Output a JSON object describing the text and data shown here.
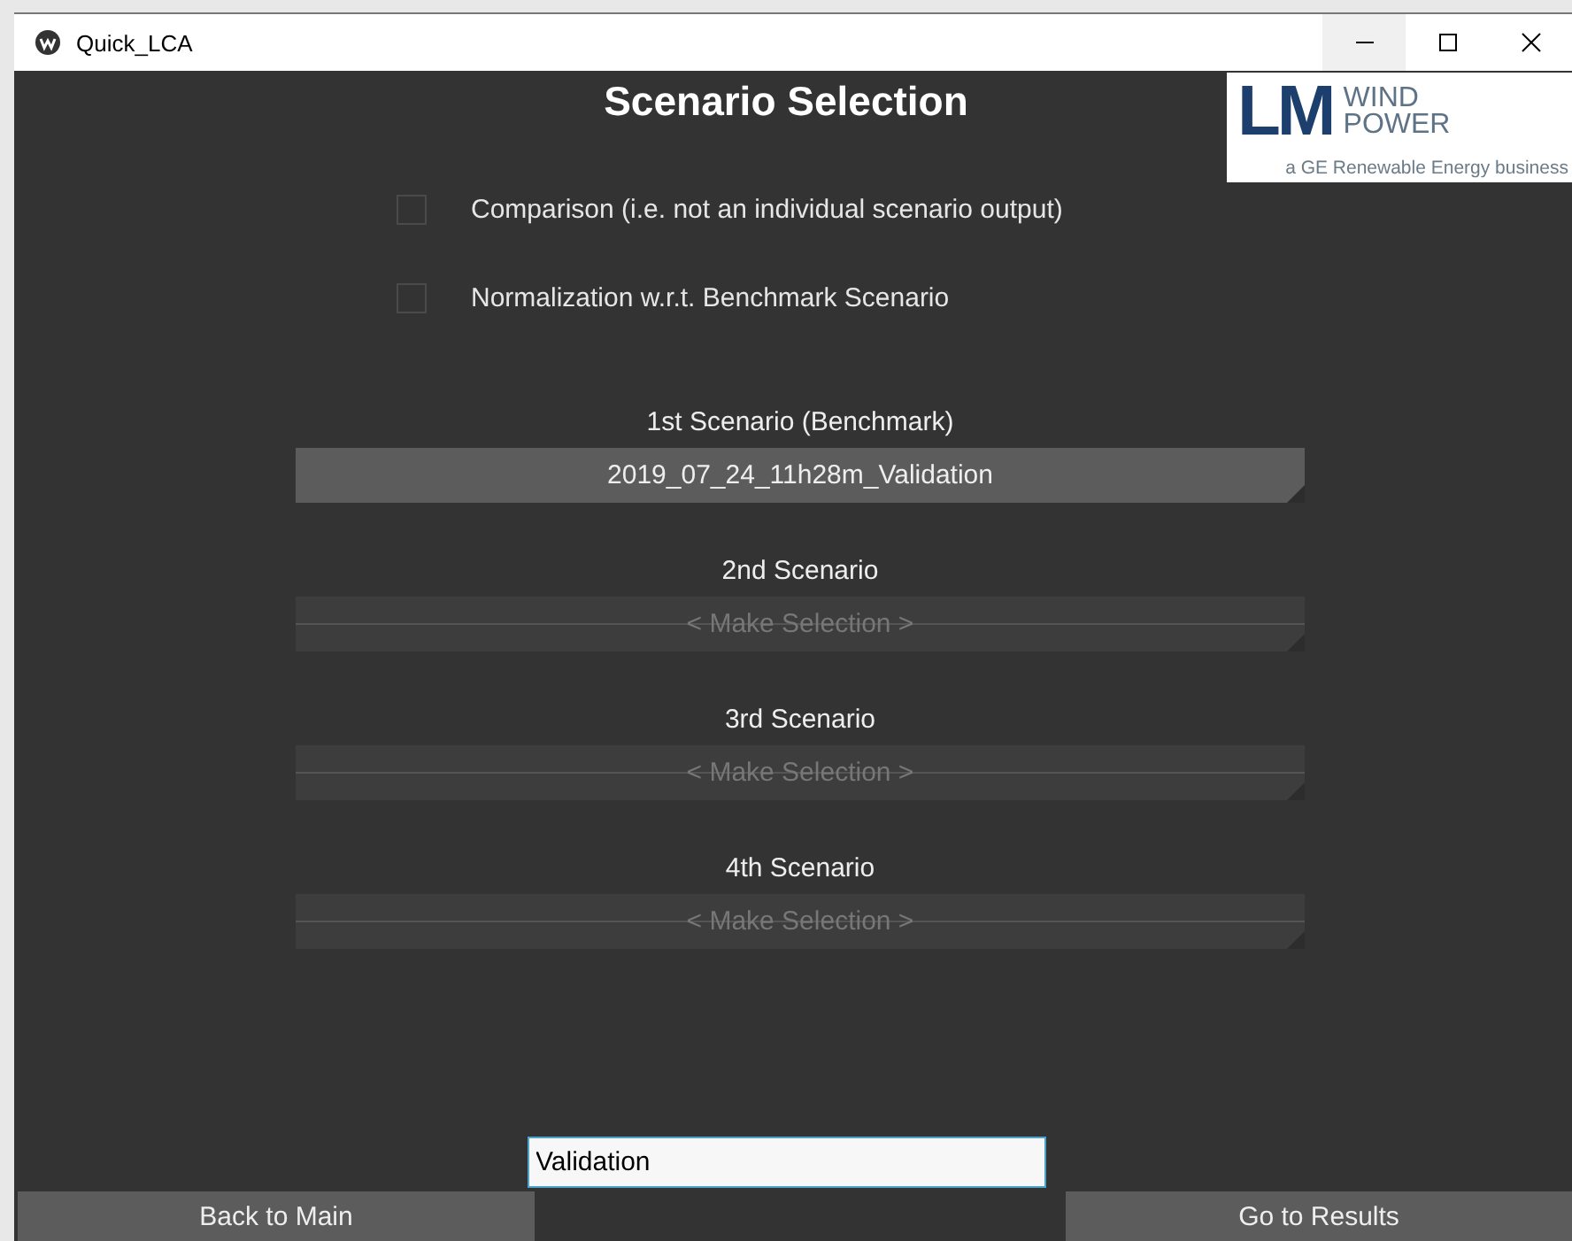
{
  "window": {
    "title": "Quick_LCA"
  },
  "heading": "Scenario Selection",
  "logo": {
    "mark": "LM",
    "word_1": "WIND",
    "word_2": "POWER",
    "tagline": "a GE Renewable Energy business"
  },
  "options": [
    {
      "label": "Comparison (i.e. not an individual scenario output)",
      "checked": false
    },
    {
      "label": "Normalization w.r.t. Benchmark Scenario",
      "checked": false
    }
  ],
  "scenarios": [
    {
      "label": "1st Scenario (Benchmark)",
      "value": "2019_07_24_11h28m_Validation",
      "disabled": false
    },
    {
      "label": "2nd Scenario",
      "value": "< Make Selection >",
      "disabled": true
    },
    {
      "label": "3rd Scenario",
      "value": "< Make Selection >",
      "disabled": true
    },
    {
      "label": "4th Scenario",
      "value": "< Make Selection >",
      "disabled": true
    }
  ],
  "name_field": {
    "value": "Validation"
  },
  "buttons": [
    {
      "label": "Back to Main"
    },
    {
      "label": "Go to Results"
    }
  ]
}
